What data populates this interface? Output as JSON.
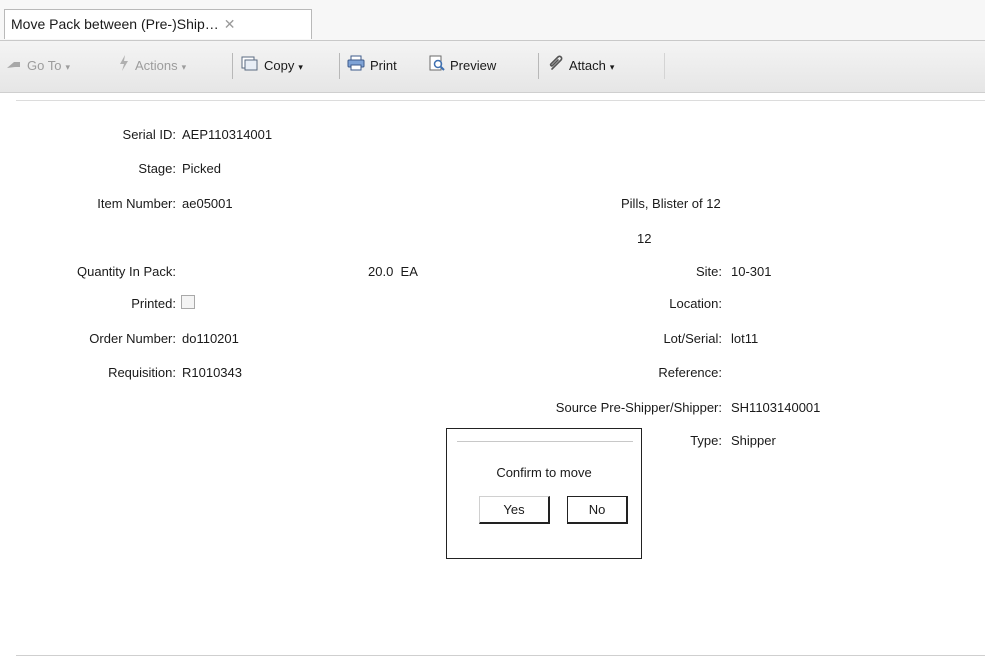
{
  "tab": {
    "title": "Move Pack between (Pre-)Ship…",
    "close_glyph": "✕"
  },
  "toolbar": {
    "goto_label": "Go To",
    "actions_label": "Actions",
    "copy_label": "Copy",
    "print_label": "Print",
    "preview_label": "Preview",
    "attach_label": "Attach",
    "caret": "▾"
  },
  "fields": {
    "serial_id": {
      "label": "Serial ID:",
      "value": "AEP110314001"
    },
    "stage": {
      "label": "Stage:",
      "value": "Picked"
    },
    "item_number": {
      "label": "Item Number:",
      "value": "ae05001"
    },
    "item_description": "Pills, Blister of 12",
    "item_description_2": "12",
    "quantity": {
      "label": "Quantity In Pack:",
      "value": "20.0",
      "unit": "EA"
    },
    "printed": {
      "label": "Printed:",
      "checked": false
    },
    "order_number": {
      "label": "Order Number:",
      "value": "do110201"
    },
    "requisition": {
      "label": "Requisition:",
      "value": "R1010343"
    },
    "site": {
      "label": "Site:",
      "value": "10-301"
    },
    "location": {
      "label": "Location:",
      "value": ""
    },
    "lot_serial": {
      "label": "Lot/Serial:",
      "value": "lot11"
    },
    "reference": {
      "label": "Reference:",
      "value": ""
    },
    "source_shipper": {
      "label": "Source Pre-Shipper/Shipper:",
      "value": "SH1103140001"
    },
    "type": {
      "label": "Type:",
      "value": "Shipper"
    }
  },
  "dialog": {
    "message": "Confirm to move",
    "yes_label": "Yes",
    "no_label": "No"
  },
  "icons": {
    "goto": "goto-arrow-icon",
    "actions": "actions-lightning-icon",
    "copy": "copy-icon",
    "print": "printer-icon",
    "preview": "preview-icon",
    "attach": "paperclip-icon"
  }
}
